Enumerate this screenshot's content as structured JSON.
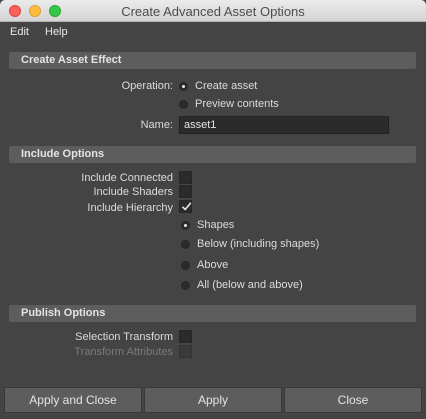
{
  "window": {
    "title": "Create Advanced Asset Options"
  },
  "menubar": {
    "items": [
      "Edit",
      "Help"
    ]
  },
  "create_asset_effect": {
    "header": "Create Asset Effect",
    "operation_label": "Operation:",
    "operation_options": [
      "Create asset",
      "Preview contents"
    ],
    "operation_selected": "Create asset",
    "name_label": "Name:",
    "name_value": "asset1"
  },
  "include_options": {
    "header": "Include Options",
    "include_connected_label": "Include Connected",
    "include_connected_checked": false,
    "include_shaders_label": "Include Shaders",
    "include_shaders_checked": false,
    "include_hierarchy_label": "Include Hierarchy",
    "include_hierarchy_checked": true,
    "hierarchy_options": [
      "Shapes",
      "Below (including shapes)",
      "Above",
      "All (below and above)"
    ],
    "hierarchy_selected": "Shapes"
  },
  "publish_options": {
    "header": "Publish Options",
    "selection_transform_label": "Selection Transform",
    "selection_transform_checked": false,
    "transform_attributes_label": "Transform Attributes",
    "transform_attributes_checked": false,
    "transform_attributes_enabled": false
  },
  "buttons": {
    "apply_and_close": "Apply and Close",
    "apply": "Apply",
    "close": "Close"
  },
  "colors": {
    "background": "#444444",
    "section_header": "#5d5d5d",
    "field": "#2b2b2b"
  }
}
